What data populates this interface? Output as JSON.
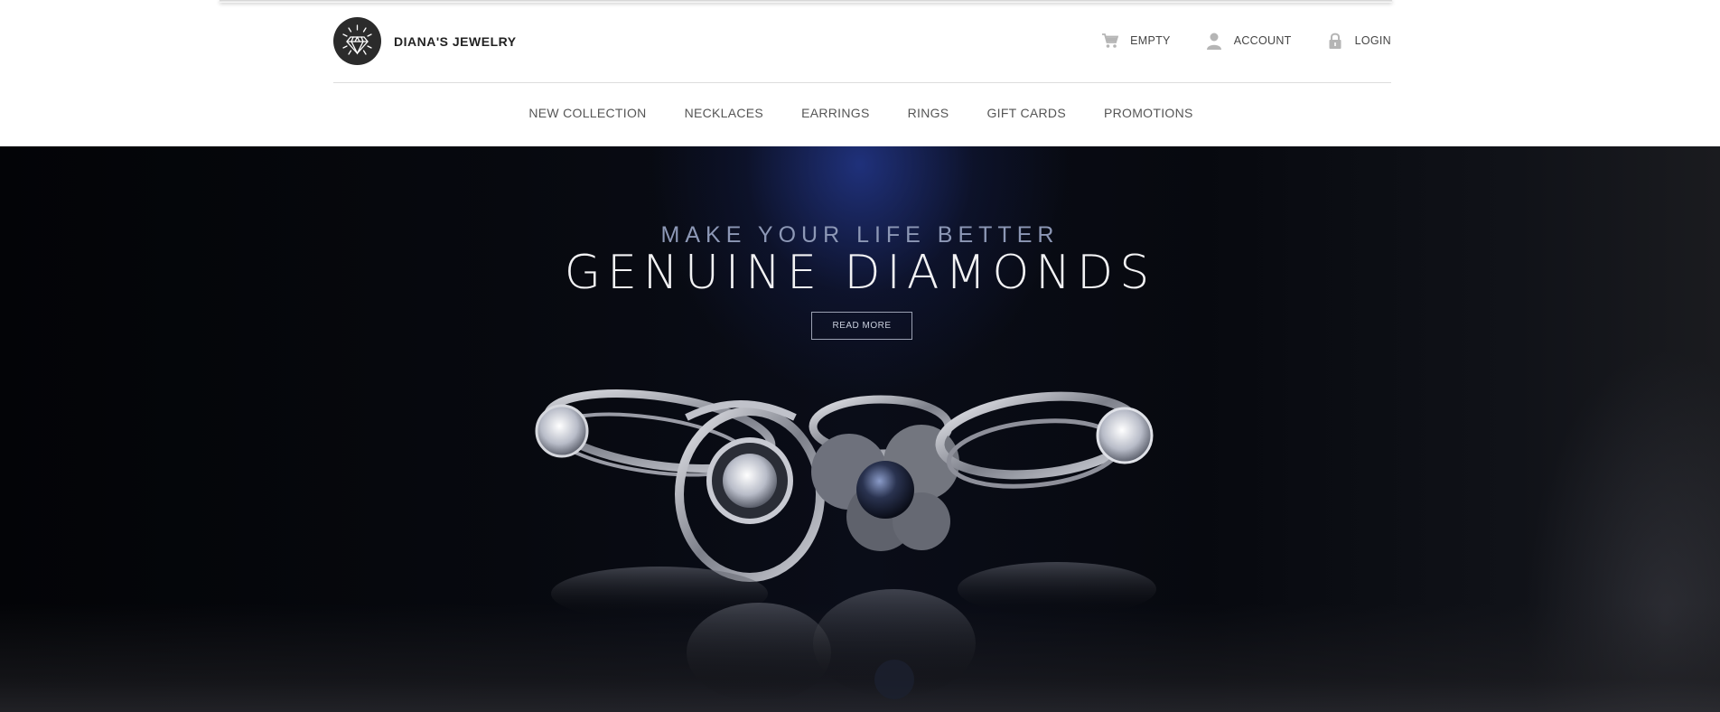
{
  "brand": {
    "name": "DIANA'S JEWELRY",
    "logo_icon": "diamond-icon"
  },
  "util_nav": {
    "cart": {
      "label": "EMPTY",
      "icon": "cart-icon"
    },
    "account": {
      "label": "ACCOUNT",
      "icon": "user-icon"
    },
    "login": {
      "label": "LOGIN",
      "icon": "lock-icon"
    }
  },
  "main_nav": {
    "items": [
      {
        "label": "NEW COLLECTION"
      },
      {
        "label": "NECKLACES"
      },
      {
        "label": "EARRINGS"
      },
      {
        "label": "RINGS"
      },
      {
        "label": "GIFT CARDS"
      },
      {
        "label": "PROMOTIONS"
      }
    ]
  },
  "hero": {
    "subtitle": "MAKE YOUR LIFE BETTER",
    "title": "GENUINE DIAMONDS",
    "button_label": "READ MORE"
  },
  "colors": {
    "nav_text": "#555555",
    "hero_accent": "#23378c",
    "logo_bg": "#2b2b2b"
  }
}
